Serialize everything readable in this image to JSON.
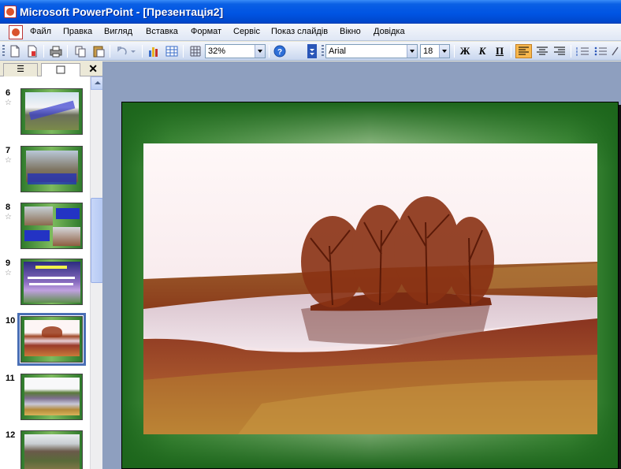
{
  "window": {
    "title": "Microsoft PowerPoint - [Презентація2]"
  },
  "menu": {
    "items": [
      "Файл",
      "Правка",
      "Вигляд",
      "Вставка",
      "Формат",
      "Сервіс",
      "Показ слайдів",
      "Вікно",
      "Довідка"
    ]
  },
  "toolbar": {
    "zoom": "32%",
    "font_name": "Arial",
    "font_size": "18",
    "bold_label": "Ж",
    "italic_label": "К",
    "underline_label": "П"
  },
  "pane": {
    "tab_outline_glyph": "☰",
    "close_glyph": "✕"
  },
  "slides": [
    {
      "number": "6",
      "star": "☆"
    },
    {
      "number": "7",
      "star": "☆"
    },
    {
      "number": "8",
      "star": "☆"
    },
    {
      "number": "9",
      "star": "☆"
    },
    {
      "number": "10",
      "star": ""
    },
    {
      "number": "11",
      "star": ""
    },
    {
      "number": "12",
      "star": ""
    }
  ],
  "selected_slide": "10",
  "colors": {
    "titlebar": "#0054e3",
    "slide_green": "#2f7a2c",
    "workspace": "#8e9fbf",
    "active_button": "#f8b84e"
  }
}
